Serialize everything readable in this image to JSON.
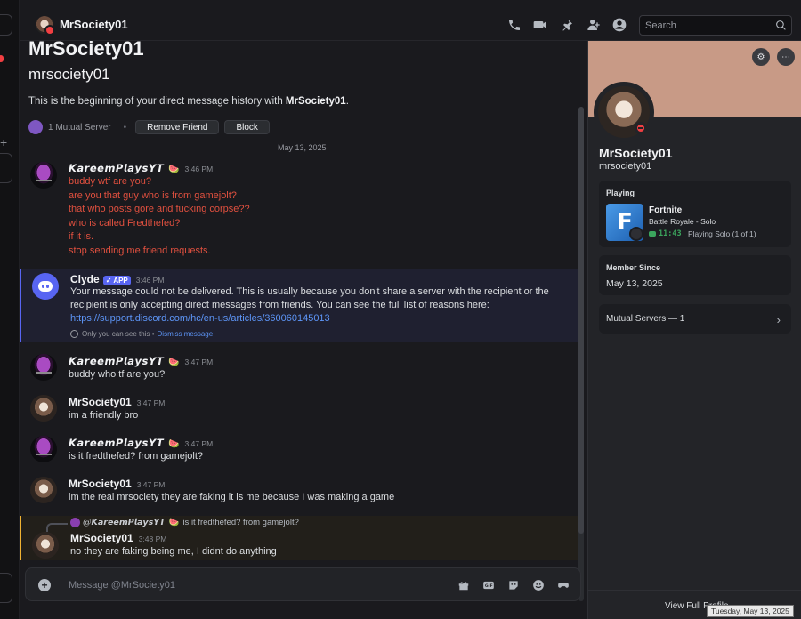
{
  "topbar": {
    "channel_name": "MrSociety01",
    "icons": [
      "phone-icon",
      "video-icon",
      "pin-icon",
      "add-friend-icon",
      "profile-icon"
    ],
    "search_placeholder": "Search"
  },
  "welcome": {
    "display_name": "MrSociety01",
    "username": "mrsociety01",
    "intro_prefix": "This is the beginning of your direct message history with ",
    "intro_name": "MrSociety01",
    "intro_suffix": ".",
    "mutual_servers": "1 Mutual Server",
    "remove_friend": "Remove Friend",
    "block": "Block"
  },
  "date_divider": "May 13, 2025",
  "messages": [
    {
      "author": "𝙆𝙖𝙧𝙚𝙚𝙢𝙋𝙡𝙖𝙮𝙨𝙔𝙏",
      "emoji": "🍉",
      "time": "3:46 PM",
      "lines": [
        "buddy wtf are you?",
        "are you that guy who is from gamejolt?",
        "that who posts gore and fucking corpse??",
        "who is called Fredthefed?",
        "if it is.",
        "stop sending me friend requests."
      ]
    },
    {
      "author": "Clyde",
      "badge": "✓ APP",
      "time": "3:46 PM",
      "lines": [
        "Your message could not be delivered. This is usually because you don't share a server with the recipient or the",
        "recipient is only accepting direct messages from friends. You can see the full list of reasons here:"
      ],
      "link": "https://support.discord.com/hc/en-us/articles/360060145013",
      "note": "Only you can see this •",
      "dismiss": "Dismiss message"
    },
    {
      "author": "𝙆𝙖𝙧𝙚𝙚𝙢𝙋𝙡𝙖𝙮𝙨𝙔𝙏",
      "emoji": "🍉",
      "time": "3:47 PM",
      "lines": [
        "buddy who tf are you?"
      ]
    },
    {
      "author": "MrSociety01",
      "time": "3:47 PM",
      "lines": [
        "im a friendly bro"
      ]
    },
    {
      "author": "𝙆𝙖𝙧𝙚𝙚𝙢𝙋𝙡𝙖𝙮𝙨𝙔𝙏",
      "emoji": "🍉",
      "time": "3:47 PM",
      "lines": [
        "is it fredthefed? from gamejolt?"
      ]
    },
    {
      "author": "MrSociety01",
      "time": "3:47 PM",
      "lines": [
        "im the real mrsociety they are faking it is me because I was making a game"
      ]
    },
    {
      "reply_to": {
        "author": "@𝙆𝙖𝙧𝙚𝙚𝙢𝙋𝙡𝙖𝙮𝙨𝙔𝙏",
        "emoji": "🍉",
        "text": "is it fredthefed? from gamejolt?"
      },
      "author": "MrSociety01",
      "time": "3:48 PM",
      "lines": [
        "no they are faking being me, I didnt do anything"
      ]
    }
  ],
  "composer": {
    "placeholder": "Message @MrSociety01",
    "icons": [
      "gift-icon",
      "gif-icon",
      "sticker-icon",
      "emoji-icon",
      "activity-icon"
    ]
  },
  "profile": {
    "display_name": "MrSociety01",
    "username": "mrsociety01",
    "playing_label": "Playing",
    "game_name": "Fortnite",
    "game_mode": "Battle Royale - Solo",
    "game_time": "11:43",
    "game_party": "Playing Solo (1 of 1)",
    "member_since_label": "Member Since",
    "member_since": "May 13, 2025",
    "mutual_servers": "Mutual Servers — 1",
    "view_full_profile": "View Full Profile"
  },
  "tooltip": "Tuesday, May 13, 2025",
  "colors": {
    "accent": "#5865f2",
    "link": "#5d95f7",
    "red_text": "#e0503f",
    "dnd_status": "#f23f42",
    "banner": "#c89a86",
    "playing_green": "#3ba55d"
  }
}
